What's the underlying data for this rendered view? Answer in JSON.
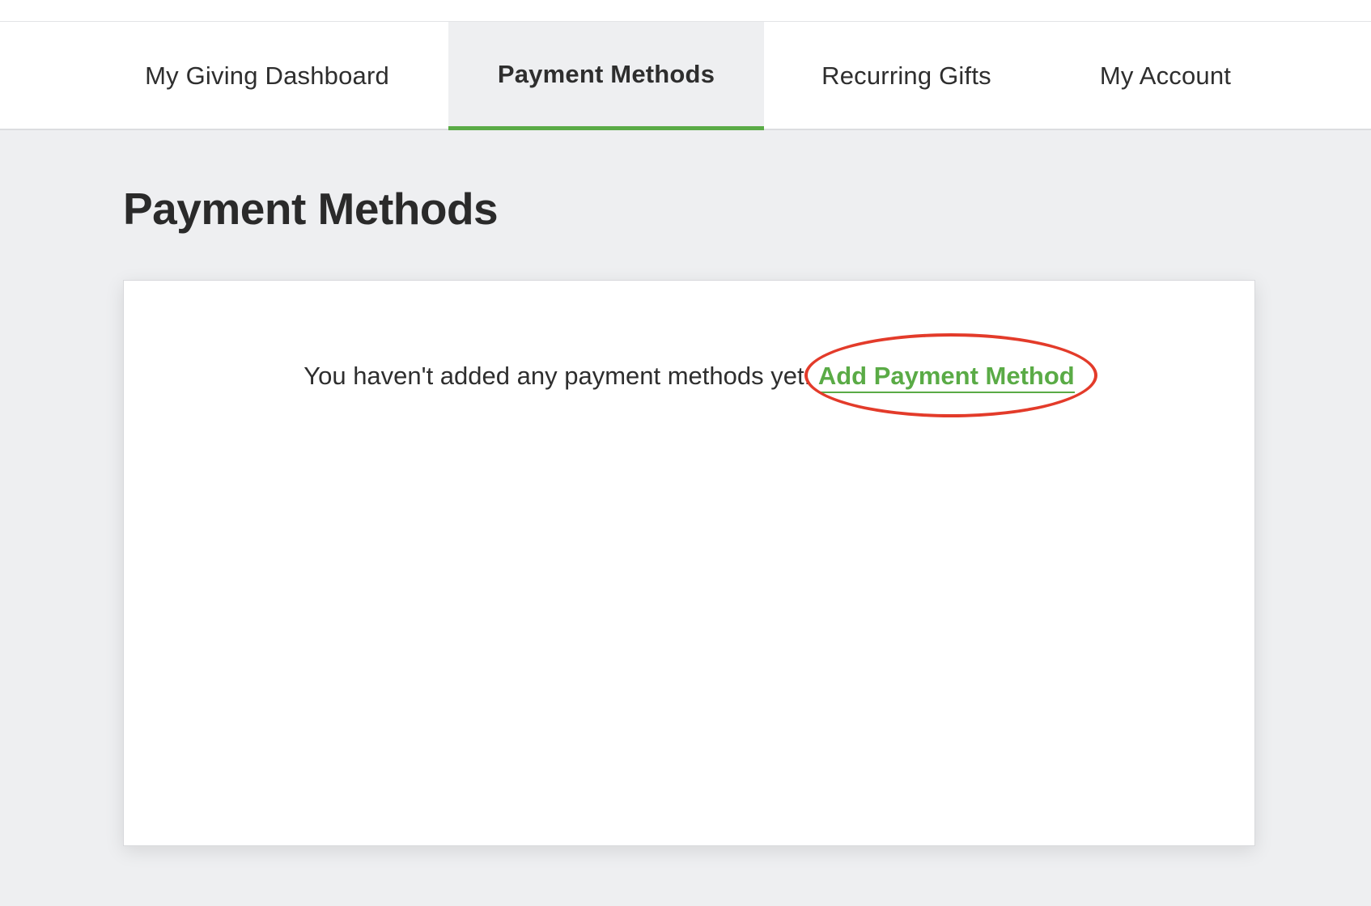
{
  "nav": {
    "tabs": [
      {
        "label": "My Giving Dashboard",
        "active": false
      },
      {
        "label": "Payment Methods",
        "active": true
      },
      {
        "label": "Recurring Gifts",
        "active": false
      },
      {
        "label": "My Account",
        "active": false
      }
    ]
  },
  "main": {
    "title": "Payment Methods",
    "empty_message": "You haven't added any payment methods yet.",
    "add_link_label": "Add Payment Method"
  },
  "colors": {
    "accent": "#5aab46",
    "annotation": "#e33b2a",
    "background": "#eeeff1"
  }
}
